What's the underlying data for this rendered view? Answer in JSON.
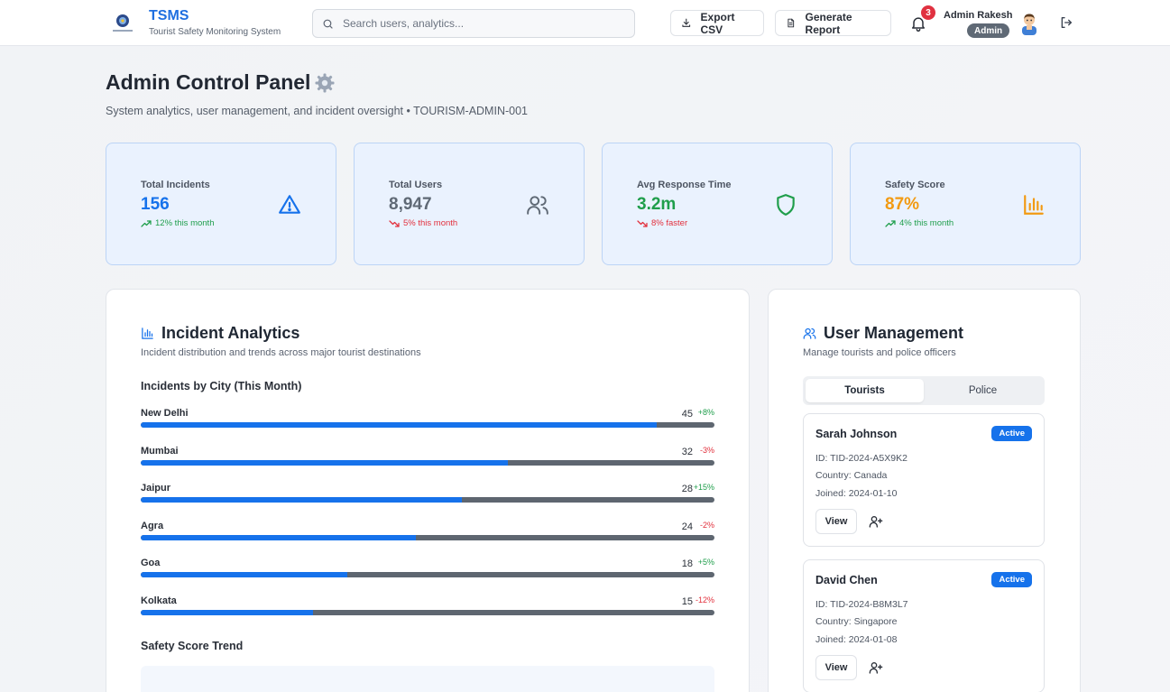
{
  "header": {
    "brand": "TSMS",
    "brand_sub": "Tourist Safety Monitoring System",
    "search_placeholder": "Search users, analytics...",
    "export_label": "Export CSV",
    "report_label": "Generate Report",
    "notification_count": "3",
    "admin_name": "Admin Rakesh",
    "admin_role": "Admin"
  },
  "page": {
    "title": "Admin Control Panel",
    "subtitle": "System analytics, user management, and incident oversight • TOURISM-ADMIN-001"
  },
  "stats": [
    {
      "label": "Total Incidents",
      "value": "156",
      "trend": "12% this month",
      "trend_dir": "up",
      "value_color": "#1672eb",
      "icon": "alert-triangle-icon"
    },
    {
      "label": "Total Users",
      "value": "8,947",
      "trend": "5% this month",
      "trend_dir": "down",
      "value_color": "#5f6975",
      "icon": "users-icon"
    },
    {
      "label": "Avg Response Time",
      "value": "3.2m",
      "trend": "8% faster",
      "trend_dir": "down",
      "value_color": "#1f9e4b",
      "icon": "shield-icon"
    },
    {
      "label": "Safety Score",
      "value": "87%",
      "trend": "4% this month",
      "trend_dir": "up",
      "value_color": "#f29a12",
      "icon": "bar-chart-icon"
    }
  ],
  "analytics": {
    "title": "Incident Analytics",
    "subtitle": "Incident distribution and trends across major tourist destinations",
    "by_city_title": "Incidents by City (This Month)",
    "trend_title": "Safety Score Trend"
  },
  "chart_data": {
    "type": "bar",
    "title": "Incidents by City (This Month)",
    "categories": [
      "New Delhi",
      "Mumbai",
      "Jaipur",
      "Agra",
      "Goa",
      "Kolkata"
    ],
    "values": [
      45,
      32,
      28,
      24,
      18,
      15
    ],
    "changes": [
      "+8%",
      "-3%",
      "+15%",
      "-2%",
      "+5%",
      "-12%"
    ],
    "max": 50
  },
  "users": {
    "title": "User Management",
    "subtitle": "Manage tourists and police officers",
    "tabs": [
      "Tourists",
      "Police"
    ],
    "view_label": "View",
    "list": [
      {
        "name": "Sarah Johnson",
        "status": "Active",
        "id": "ID: TID-2024-A5X9K2",
        "country": "Country: Canada",
        "joined": "Joined: 2024-01-10"
      },
      {
        "name": "David Chen",
        "status": "Active",
        "id": "ID: TID-2024-B8M3L7",
        "country": "Country: Singapore",
        "joined": "Joined: 2024-01-08"
      }
    ]
  },
  "colors": {
    "accent": "#1672eb",
    "positive": "#1f9e4b",
    "negative": "#e2303c"
  }
}
